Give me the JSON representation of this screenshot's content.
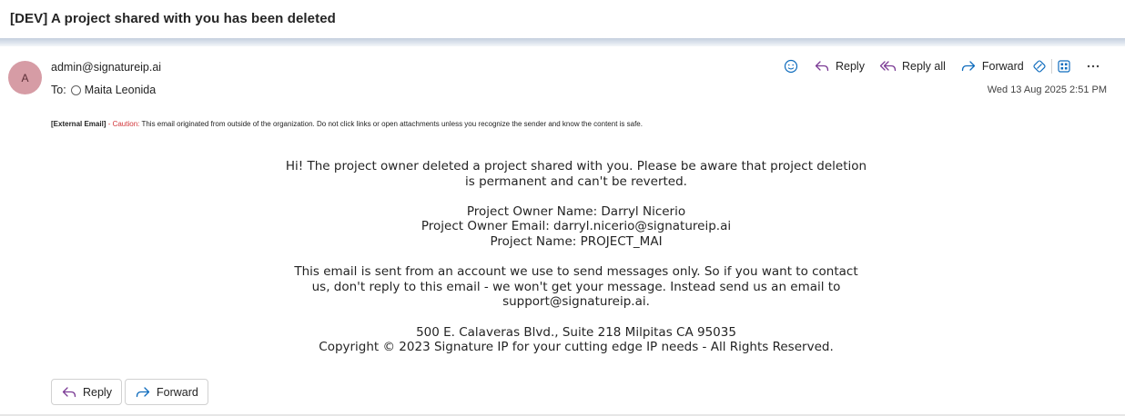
{
  "subject": "[DEV] A project shared with you has been deleted",
  "sender": {
    "avatar_initial": "A",
    "email": "admin@signatureip.ai",
    "to_label": "To:",
    "recipient": "Maita Leonida",
    "avatar_color": "#d69ca5"
  },
  "toolbar": {
    "reply_label": "Reply",
    "reply_all_label": "Reply all",
    "forward_label": "Forward",
    "icons": [
      "emoji-icon",
      "reply-icon",
      "reply-all-icon",
      "forward-icon",
      "loop-icon",
      "apps-icon",
      "more-icon"
    ],
    "accent_color": "#0f6cbd",
    "reply_color": "#7b3b95"
  },
  "date": "Wed 13 Aug 2025 2:51 PM",
  "external_notice": {
    "tag": "[External Email]",
    "dash": " - ",
    "caution": "Caution:",
    "text": " This email originated from outside of the organization. Do not click links or open attachments unless you recognize the sender and know the content is safe."
  },
  "body": {
    "intro_line1": "Hi! The project owner deleted a project shared with you. Please be aware that project deletion",
    "intro_line2": "is permanent and can't be reverted.",
    "owner_name": "Project Owner Name: Darryl Nicerio",
    "owner_email": "Project Owner Email: darryl.nicerio@signatureip.ai",
    "project_name": "Project Name: PROJECT_MAI",
    "notice_line1": "This email is sent from an account we use to send messages only. So if you want to contact",
    "notice_line2": "us, don't reply to this email - we won't get your message. Instead send us an email to",
    "notice_line3": "support@signatureip.ai.",
    "address": "500 E. Calaveras Blvd., Suite 218 Milpitas CA 95035",
    "copyright": "Copyright © 2023 Signature IP for your cutting edge IP needs - All Rights Reserved."
  },
  "footer": {
    "reply_label": "Reply",
    "forward_label": "Forward"
  }
}
